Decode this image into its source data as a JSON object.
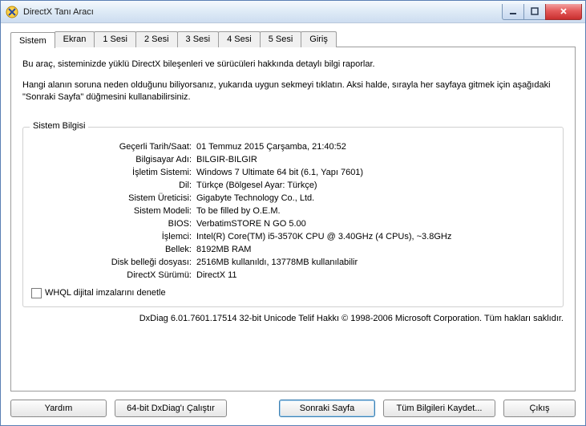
{
  "window": {
    "title": "DirectX Tanı Aracı"
  },
  "tabs": [
    {
      "label": "Sistem"
    },
    {
      "label": "Ekran"
    },
    {
      "label": "1 Sesi"
    },
    {
      "label": "2 Sesi"
    },
    {
      "label": "3 Sesi"
    },
    {
      "label": "4 Sesi"
    },
    {
      "label": "5 Sesi"
    },
    {
      "label": "Giriş"
    }
  ],
  "intro": {
    "p1": "Bu araç, sisteminizde yüklü DirectX bileşenleri ve sürücüleri hakkında detaylı bilgi raporlar.",
    "p2": "Hangi alanın soruna neden olduğunu biliyorsanız, yukarıda uygun sekmeyi tıklatın.  Aksi halde, sırayla her sayfaya gitmek için aşağıdaki \"Sonraki Sayfa\" düğmesini kullanabilirsiniz."
  },
  "group": {
    "legend": "Sistem Bilgisi",
    "rows": [
      {
        "label": "Geçerli Tarih/Saat:",
        "value": "01 Temmuz 2015 Çarşamba, 21:40:52"
      },
      {
        "label": "Bilgisayar Adı:",
        "value": "BILGIR-BILGIR"
      },
      {
        "label": "İşletim Sistemi:",
        "value": "Windows 7 Ultimate 64 bit (6.1, Yapı 7601)"
      },
      {
        "label": "Dil:",
        "value": "Türkçe (Bölgesel Ayar: Türkçe)"
      },
      {
        "label": "Sistem Üreticisi:",
        "value": "Gigabyte Technology Co., Ltd."
      },
      {
        "label": "Sistem Modeli:",
        "value": "To be filled by O.E.M."
      },
      {
        "label": "BIOS:",
        "value": "VerbatimSTORE N GO 5.00"
      },
      {
        "label": "İşlemci:",
        "value": "Intel(R) Core(TM) i5-3570K CPU @ 3.40GHz (4 CPUs), ~3.8GHz"
      },
      {
        "label": "Bellek:",
        "value": "8192MB RAM"
      },
      {
        "label": "Disk belleği dosyası:",
        "value": "2516MB kullanıldı, 13778MB kullanılabilir"
      },
      {
        "label": "DirectX Sürümü:",
        "value": "DirectX 11"
      }
    ],
    "checkbox": "WHQL dijital imzalarını denetle"
  },
  "footer": "DxDiag 6.01.7601.17514 32-bit Unicode  Telif Hakkı © 1998-2006 Microsoft Corporation.  Tüm hakları saklıdır.",
  "buttons": {
    "help": "Yardım",
    "run64": "64-bit DxDiag'ı Çalıştır",
    "next": "Sonraki Sayfa",
    "save": "Tüm Bilgileri Kaydet...",
    "exit": "Çıkış"
  }
}
